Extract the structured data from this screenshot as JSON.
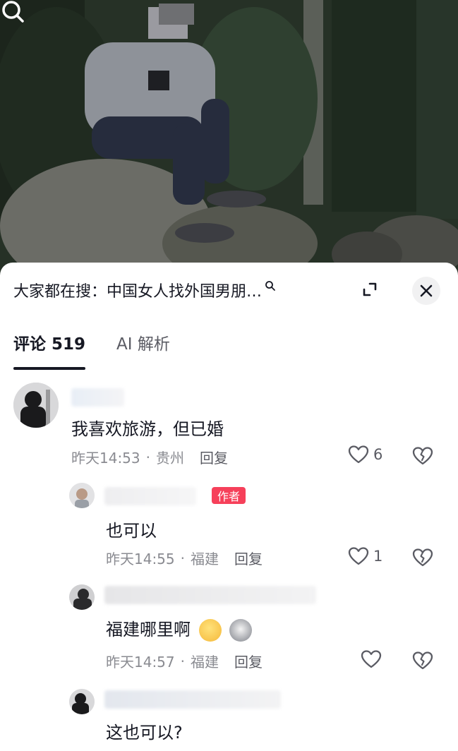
{
  "header": {
    "search_prefix": "大家都在搜：",
    "search_query": "中国女人找外国男朋…"
  },
  "tabs": [
    {
      "label": "评论 519",
      "active": true
    },
    {
      "label": "AI 解析",
      "active": false
    }
  ],
  "comments": [
    {
      "text": "我喜欢旅游，但已婚",
      "time": "昨天14:53",
      "location": "贵州",
      "reply_label": "回复",
      "likes": "6"
    },
    {
      "text": "也可以",
      "author_badge": "作者",
      "time": "昨天14:55",
      "location": "福建",
      "reply_label": "回复",
      "likes": "1"
    },
    {
      "text": "福建哪里啊",
      "emojis": [
        "thinking-face-emoji",
        "cat-face-emoji"
      ],
      "time": "昨天14:57",
      "location": "福建",
      "reply_label": "回复",
      "likes": ""
    },
    {
      "text": "这也可以?"
    }
  ],
  "meta_separator": "·",
  "colors": {
    "badge": "#f6405a",
    "text_primary": "#161823",
    "text_secondary": "#8a8b91"
  }
}
